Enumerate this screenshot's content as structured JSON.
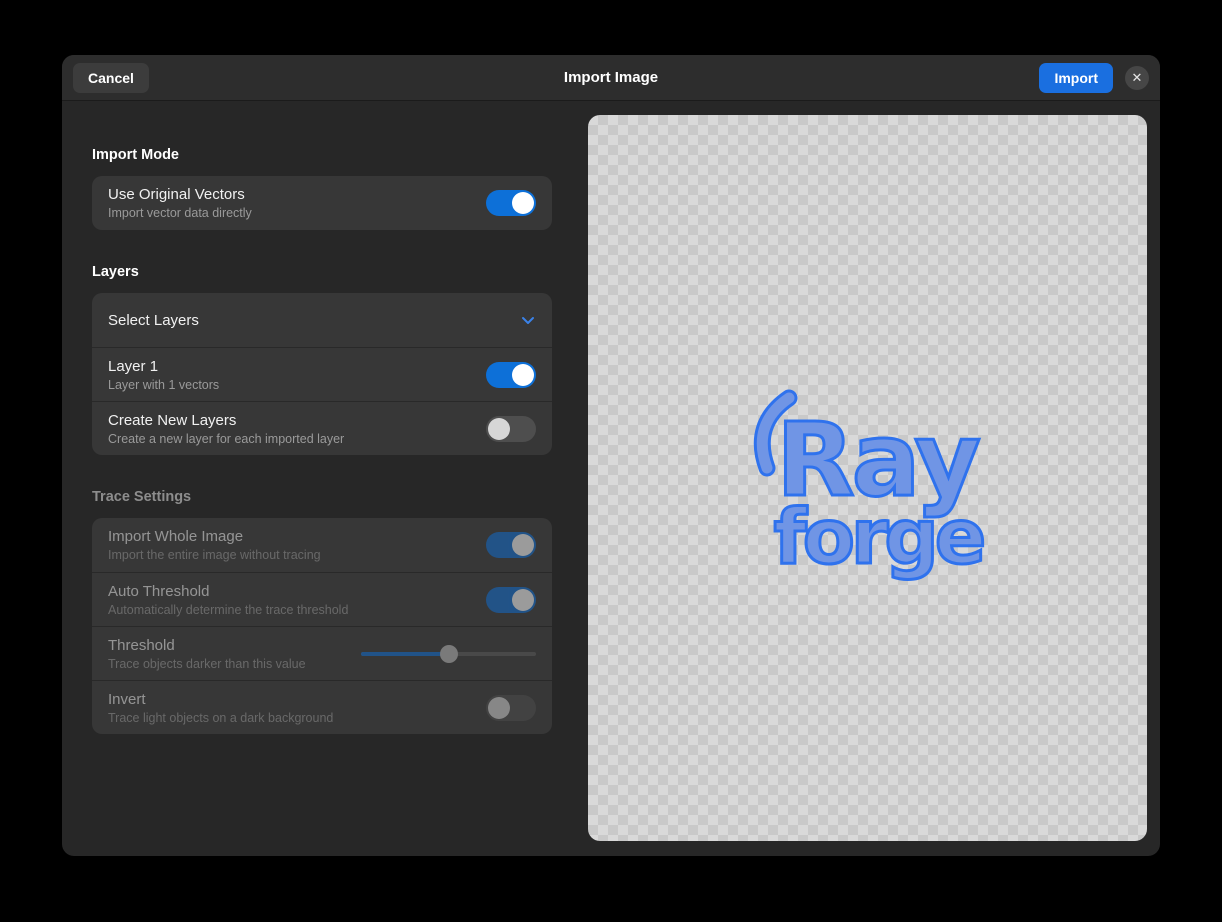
{
  "colors": {
    "accent_button": "#1a6fe0",
    "accent_toggle": "#0d70d8",
    "accent_chevron": "#3a82e8",
    "logo_fill": "#7095e5",
    "logo_stroke": "#2f72ed"
  },
  "header": {
    "title": "Import Image",
    "cancel_label": "Cancel",
    "import_label": "Import",
    "close_icon": "✕"
  },
  "panel": {
    "sections": [
      {
        "header": "Import Mode"
      },
      {
        "header": "Layers"
      },
      {
        "header": "Trace Settings"
      }
    ],
    "rows": {
      "use_original_vectors": {
        "title": "Use Original Vectors",
        "subtitle": "Import vector data directly",
        "state": "on"
      },
      "select_layers": {
        "title": "Select Layers"
      },
      "layer1": {
        "title": "Layer 1",
        "subtitle": "Layer with 1 vectors",
        "state": "on"
      },
      "create_new_layers": {
        "title": "Create New Layers",
        "subtitle": "Create a new layer for each imported layer",
        "state": "off"
      },
      "import_whole_image": {
        "title": "Import Whole Image",
        "subtitle": "Import the entire image without tracing",
        "state": "on",
        "disabled": true
      },
      "auto_threshold": {
        "title": "Auto Threshold",
        "subtitle": "Automatically determine the trace threshold",
        "state": "on",
        "disabled": true
      },
      "threshold": {
        "title": "Threshold",
        "subtitle": "Trace objects darker than this value",
        "value_percent": 50,
        "disabled": true
      },
      "invert": {
        "title": "Invert",
        "subtitle": "Trace light objects on a dark background",
        "state": "off",
        "disabled": true
      }
    }
  },
  "preview": {
    "logo_line1": "Ray",
    "logo_line2": "forge"
  }
}
